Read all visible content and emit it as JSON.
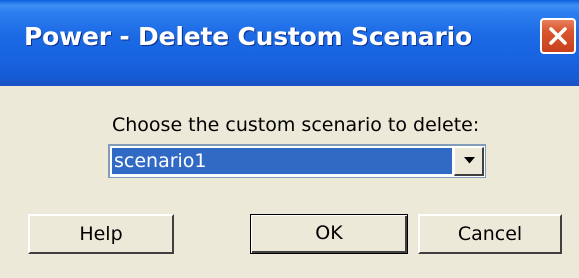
{
  "window": {
    "title": "Power - Delete Custom Scenario",
    "close_icon": "close-icon"
  },
  "dialog": {
    "prompt": "Choose the custom scenario to delete:",
    "scenario_select": {
      "selected": "scenario1",
      "arrow_icon": "chevron-down-icon"
    },
    "buttons": {
      "help": "Help",
      "ok": "OK",
      "cancel": "Cancel"
    }
  },
  "colors": {
    "titlebar": "#1d6ae5",
    "close_button": "#d9562f",
    "selection": "#316ac5",
    "dialog_background": "#ece9d8"
  }
}
